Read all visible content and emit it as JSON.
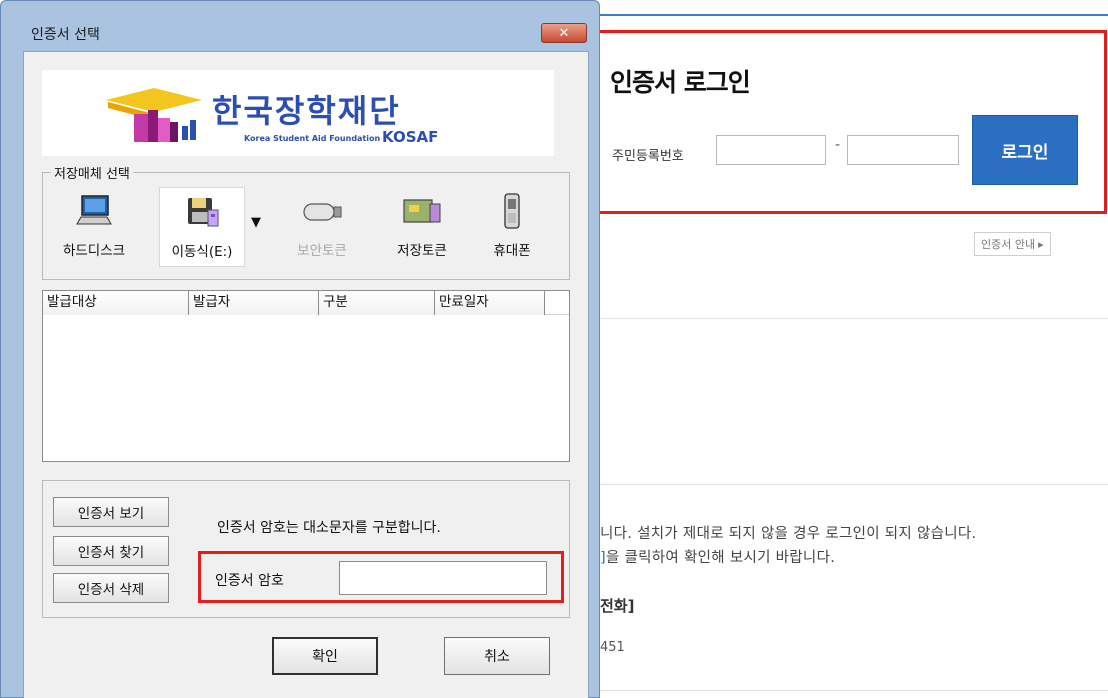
{
  "web": {
    "login_title": "인증서 로그인",
    "rrn_label": "주민등록번호",
    "rrn_dash": "-",
    "login_button": "로그인",
    "cert_guide": "인증서 안내",
    "cert_guide_arrow": "▸",
    "notice_line1": "니다. 설치가 제대로 되지 않을 경우 로그인이 되지 않습니다.",
    "notice_line2_bracket": "]",
    "notice_line2": "을 클릭하여 확인해 보시기 바랍니다.",
    "phone_fragment": "전화]",
    "number_fragment": "451",
    "accent_color": "#2b6fc2",
    "highlight_color": "#e41e1e"
  },
  "dialog": {
    "title": "인증서 선택",
    "close_label": "✕",
    "logo": {
      "korean": "한국장학재단",
      "english": "Korea Student Aid Foundation",
      "kosaf": "KOSAF"
    },
    "media_group_label": "저장매체 선택",
    "media": [
      {
        "label": "하드디스크",
        "icon": "hard-disk-icon",
        "selected": false,
        "disabled": false
      },
      {
        "label": "이동식(E:)",
        "icon": "removable-drive-icon",
        "selected": true,
        "disabled": false
      },
      {
        "label": "보안토큰",
        "icon": "security-token-icon",
        "selected": false,
        "disabled": true
      },
      {
        "label": "저장토큰",
        "icon": "storage-token-icon",
        "selected": false,
        "disabled": false
      },
      {
        "label": "휴대폰",
        "icon": "mobile-phone-icon",
        "selected": false,
        "disabled": false
      }
    ],
    "media_dropdown_arrow": "▼",
    "columns": [
      "발급대상",
      "발급자",
      "구분",
      "만료일자"
    ],
    "buttons": {
      "view": "인증서 보기",
      "find": "인증서 찾기",
      "delete": "인증서 삭제",
      "ok": "확인",
      "cancel": "취소"
    },
    "password_hint": "인증서 암호는 대소문자를 구분합니다.",
    "password_label": "인증서 암호",
    "password_value": ""
  }
}
